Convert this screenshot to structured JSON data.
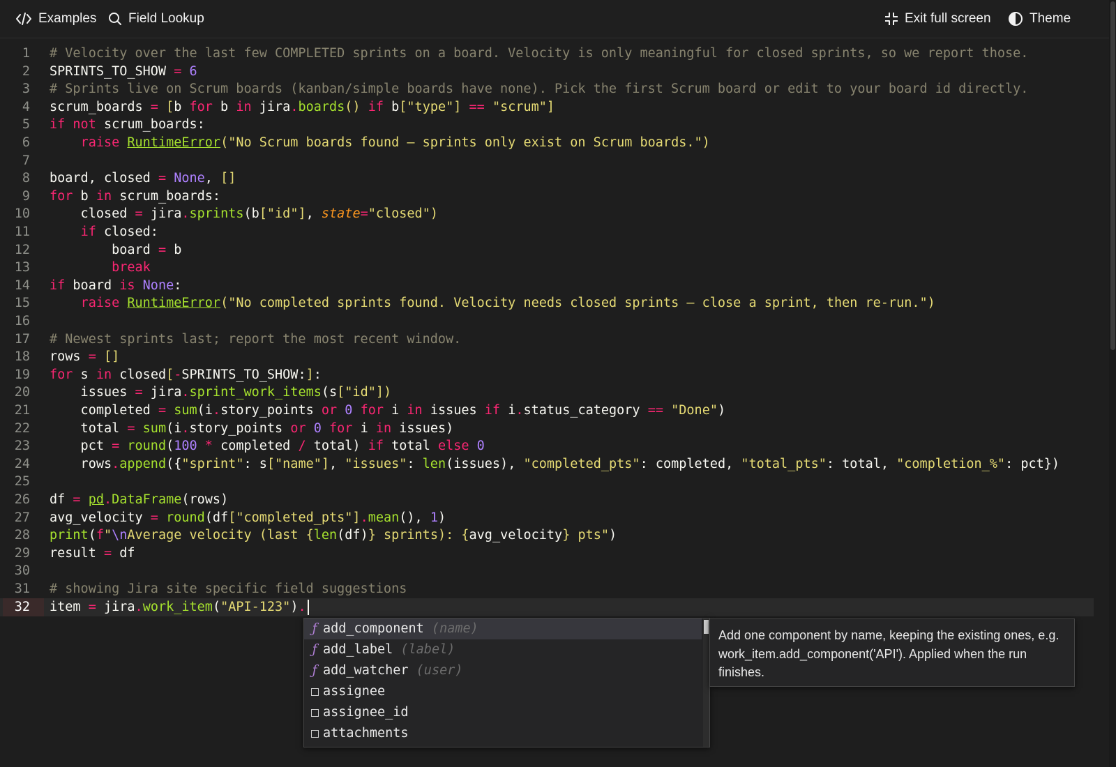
{
  "toolbar": {
    "examples_label": "Examples",
    "field_lookup_label": "Field Lookup",
    "exit_fullscreen_label": "Exit full screen",
    "theme_label": "Theme"
  },
  "editor": {
    "current_line": 32,
    "lines": [
      {
        "n": "1",
        "html": "<span class='cm'># Velocity over the last few COMPLETED sprints on a board. Velocity is only meaningful for closed sprints, so we report those.</span>"
      },
      {
        "n": "2",
        "html": "SPRINTS_TO_SHOW <span class='op'>=</span> <span class='cn'>6</span>"
      },
      {
        "n": "3",
        "html": "<span class='cm'># Sprints live on Scrum boards (kanban/simple boards have none). Pick the first Scrum board or edit to your board id directly.</span>"
      },
      {
        "n": "4",
        "html": "scrum_boards <span class='op'>=</span> <span class='br'>[</span>b <span class='kw'>for</span> b <span class='kw'>in</span> jira<span class='op'>.</span><span class='fn'>boards</span><span class='br'>()</span> <span class='kw'>if</span> b<span class='br'>[</span><span class='st'>\"type\"</span><span class='br'>]</span> <span class='op'>==</span> <span class='st'>\"scrum\"</span><span class='br'>]</span>"
      },
      {
        "n": "5",
        "html": "<span class='kw'>if</span> <span class='kw'>not</span> scrum_boards:"
      },
      {
        "n": "6",
        "html": "    <span class='kw'>raise</span> <span class='fnu'>RuntimeError</span><span class='br'>(</span><span class='st'>\"No Scrum boards found — sprints only exist on Scrum boards.\"</span><span class='br'>)</span>"
      },
      {
        "n": "7",
        "html": ""
      },
      {
        "n": "8",
        "html": "board, closed <span class='op'>=</span> <span class='cn'>None</span>, <span class='br'>[]</span>"
      },
      {
        "n": "9",
        "html": "<span class='kw'>for</span> b <span class='kw'>in</span> scrum_boards:"
      },
      {
        "n": "10",
        "html": "    closed <span class='op'>=</span> jira<span class='op'>.</span><span class='fn'>sprints</span>(b<span class='br'>[</span><span class='st'>\"id\"</span><span class='br'>]</span>, <span class='pm'>state</span><span class='op'>=</span><span class='st'>\"closed\"</span><span class='br'>)</span>"
      },
      {
        "n": "11",
        "html": "    <span class='kw'>if</span> closed:"
      },
      {
        "n": "12",
        "html": "        board <span class='op'>=</span> b"
      },
      {
        "n": "13",
        "html": "        <span class='kw'>break</span>"
      },
      {
        "n": "14",
        "html": "<span class='kw'>if</span> board <span class='kw'>is</span> <span class='cn'>None</span>:"
      },
      {
        "n": "15",
        "html": "    <span class='kw'>raise</span> <span class='fnu'>RuntimeError</span><span class='br'>(</span><span class='st'>\"No completed sprints found. Velocity needs closed sprints — close a sprint, then re-run.\"</span><span class='br'>)</span>"
      },
      {
        "n": "16",
        "html": ""
      },
      {
        "n": "17",
        "html": "<span class='cm'># Newest sprints last; report the most recent window.</span>"
      },
      {
        "n": "18",
        "html": "rows <span class='op'>=</span> <span class='br'>[]</span>"
      },
      {
        "n": "19",
        "html": "<span class='kw'>for</span> s <span class='kw'>in</span> closed<span class='br'>[</span><span class='op'>-</span>SPRINTS_TO_SHOW:<span class='br'>]</span>:"
      },
      {
        "n": "20",
        "html": "    issues <span class='op'>=</span> jira<span class='op'>.</span><span class='fn'>sprint_work_items</span>(s<span class='br'>[</span><span class='st'>\"id\"</span><span class='br'>])</span>"
      },
      {
        "n": "21",
        "html": "    completed <span class='op'>=</span> <span class='fn'>sum</span>(i<span class='op'>.</span>story_points <span class='kw'>or</span> <span class='cn'>0</span> <span class='kw'>for</span> i <span class='kw'>in</span> issues <span class='kw'>if</span> i<span class='op'>.</span>status_category <span class='op'>==</span> <span class='st'>\"Done\"</span>)"
      },
      {
        "n": "22",
        "html": "    total <span class='op'>=</span> <span class='fn'>sum</span>(i<span class='op'>.</span>story_points <span class='kw'>or</span> <span class='cn'>0</span> <span class='kw'>for</span> i <span class='kw'>in</span> issues)"
      },
      {
        "n": "23",
        "html": "    pct <span class='op'>=</span> <span class='fn'>round</span>(<span class='cn'>100</span> <span class='op'>*</span> completed <span class='op'>/</span> total) <span class='kw'>if</span> total <span class='kw'>else</span> <span class='cn'>0</span>"
      },
      {
        "n": "24",
        "html": "    rows<span class='op'>.</span><span class='fn'>append</span>({<span class='st'>\"sprint\"</span>: s<span class='br'>[</span><span class='st'>\"name\"</span><span class='br'>]</span>, <span class='st'>\"issues\"</span>: <span class='fn'>len</span>(issues), <span class='st'>\"completed_pts\"</span>: completed, <span class='st'>\"total_pts\"</span>: total, <span class='st'>\"completion_%\"</span>: pct})"
      },
      {
        "n": "25",
        "html": ""
      },
      {
        "n": "26",
        "html": "df <span class='op'>=</span> <span class='fnu'>pd</span><span class='op'>.</span><span class='fn'>DataFrame</span>(rows)"
      },
      {
        "n": "27",
        "html": "avg_velocity <span class='op'>=</span> <span class='fn'>round</span>(df<span class='br'>[</span><span class='st'>\"completed_pts\"</span><span class='br'>]</span><span class='op'>.</span><span class='fn'>mean</span>(), <span class='cn'>1</span>)"
      },
      {
        "n": "28",
        "html": "<span class='fn'>print</span>(<span class='kw'>f</span><span class='st'>\"</span><span class='cn'>\\n</span><span class='st'>Average velocity (last </span><span class='br'>{</span><span class='fn'>len</span>(df)<span class='br'>}</span><span class='st'> sprints): </span><span class='br'>{</span>avg_velocity<span class='br'>}</span><span class='st'> pts\"</span>)"
      },
      {
        "n": "29",
        "html": "result <span class='op'>=</span> df"
      },
      {
        "n": "30",
        "html": ""
      },
      {
        "n": "31",
        "html": "<span class='cm'># showing Jira site specific field suggestions</span>"
      },
      {
        "n": "32",
        "html": "item <span class='op'>=</span> jira<span class='op'>.</span><span class='fn'>work_item</span>(<span class='st'>\"API-123\"</span>)<span class='op'>.</span>"
      }
    ]
  },
  "suggestions": {
    "items": [
      {
        "kind": "function",
        "icon": "function-icon",
        "label": "add_component",
        "signature": "(name)",
        "selected": true
      },
      {
        "kind": "function",
        "icon": "function-icon",
        "label": "add_label",
        "signature": "(label)",
        "selected": false
      },
      {
        "kind": "function",
        "icon": "function-icon",
        "label": "add_watcher",
        "signature": "(user)",
        "selected": false
      },
      {
        "kind": "property",
        "icon": "property-icon",
        "label": "assignee",
        "signature": "",
        "selected": false
      },
      {
        "kind": "property",
        "icon": "property-icon",
        "label": "assignee_id",
        "signature": "",
        "selected": false
      },
      {
        "kind": "property",
        "icon": "property-icon",
        "label": "attachments",
        "signature": "",
        "selected": false
      }
    ],
    "doc": "Add one component by name, keeping the existing ones, e.g. work_item.add_component('API'). Applied when the run finishes."
  }
}
